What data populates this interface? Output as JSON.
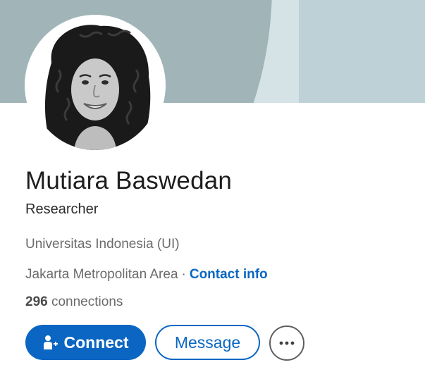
{
  "profile": {
    "name": "Mutiara Baswedan",
    "headline": "Researcher",
    "education": "Universitas Indonesia (UI)",
    "location": "Jakarta Metropolitan Area",
    "separator": "·",
    "contact_info_label": "Contact info",
    "connections_count": "296",
    "connections_label": "connections"
  },
  "actions": {
    "connect_label": "Connect",
    "message_label": "Message",
    "more_icon": "ellipsis-icon"
  },
  "colors": {
    "accent": "#0a66c2",
    "cover_dark": "#a1b5b8",
    "cover_light": "#d6e3e6",
    "cover_right": "#bdd1d6"
  }
}
